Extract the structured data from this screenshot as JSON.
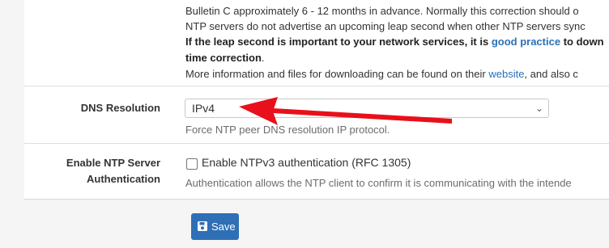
{
  "leap_info": {
    "line1": "Bulletin C approximately 6 - 12 months in advance. Normally this correction should o",
    "line2": "NTP servers do not advertise an upcoming leap second when other NTP servers sync",
    "line3_bold": "If the leap second is important to your network services, it is ",
    "line3_link": "good practice",
    "line3_bold_tail": " to down",
    "line4_bold": "time correction",
    "line4_tail": ".",
    "line5_start": "More information and files for downloading can be found on their ",
    "line5_link": "website",
    "line5_tail": ", and also c"
  },
  "dns_resolution": {
    "label": "DNS Resolution",
    "selected": "IPv4",
    "help": "Force NTP peer DNS resolution IP protocol."
  },
  "ntp_auth": {
    "label_line1": "Enable NTP Server",
    "label_line2": "Authentication",
    "checkbox_label": "Enable NTPv3 authentication (RFC 1305)",
    "checked": false,
    "help": "Authentication allows the NTP client to confirm it is communicating with the intende"
  },
  "save_button": {
    "label": "Save"
  },
  "annotation": {
    "arrow_color": "#e8101a"
  }
}
